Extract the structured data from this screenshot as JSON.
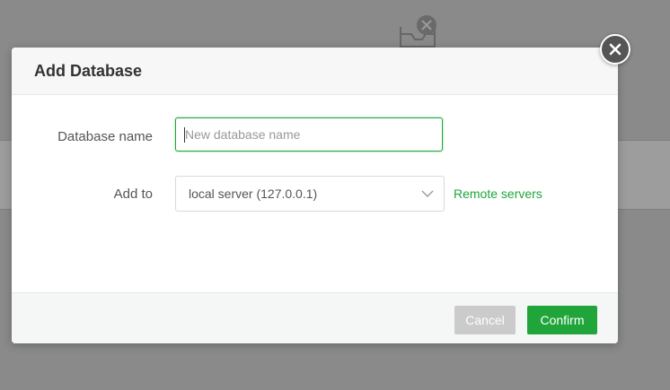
{
  "modal": {
    "title": "Add Database",
    "fields": {
      "name_label": "Database name",
      "name_placeholder": "New database name",
      "name_value": "",
      "addto_label": "Add to",
      "addto_selected": "local server (127.0.0.1)"
    },
    "remote_link": "Remote servers",
    "buttons": {
      "cancel": "Cancel",
      "confirm": "Confirm"
    }
  },
  "colors": {
    "accent": "#20a53a",
    "cancel_bg": "#cbcbcb",
    "close_bg": "#555555"
  },
  "icons": {
    "close": "close-icon",
    "chevron": "chevron-down-icon",
    "background": "database-error-icon"
  }
}
